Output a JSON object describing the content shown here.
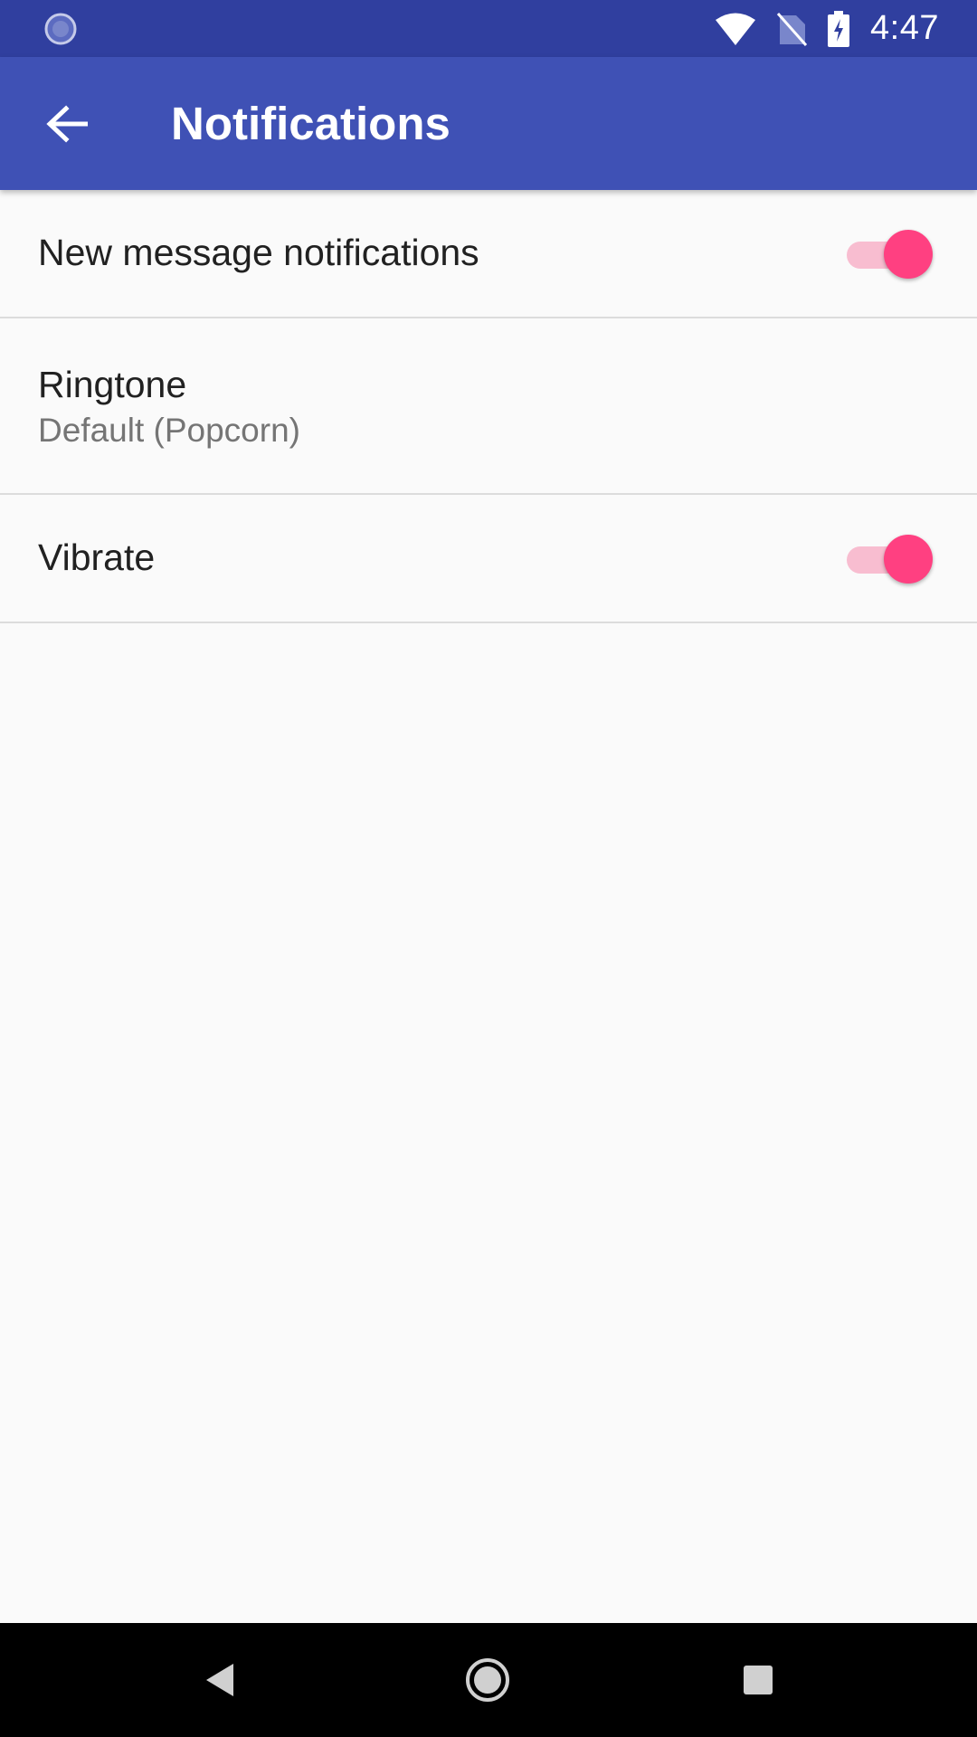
{
  "status_bar": {
    "time": "4:47",
    "left_icon": "loading-circle-icon",
    "icons": [
      "wifi-icon",
      "no-sim-icon",
      "battery-charging-icon"
    ]
  },
  "app_bar": {
    "title": "Notifications",
    "back_icon": "arrow-back-icon"
  },
  "preferences": {
    "new_message": {
      "title": "New message notifications",
      "checked": true
    },
    "ringtone": {
      "title": "Ringtone",
      "summary": "Default (Popcorn)"
    },
    "vibrate": {
      "title": "Vibrate",
      "checked": true
    }
  },
  "nav_bar": {
    "buttons": [
      "nav-back-icon",
      "nav-home-icon",
      "nav-recents-icon"
    ]
  },
  "colors": {
    "status_bar": "#303f9f",
    "app_bar": "#3f51b5",
    "accent": "#ff4081",
    "accent_track": "#f8bdd0",
    "background": "#fafafa"
  }
}
